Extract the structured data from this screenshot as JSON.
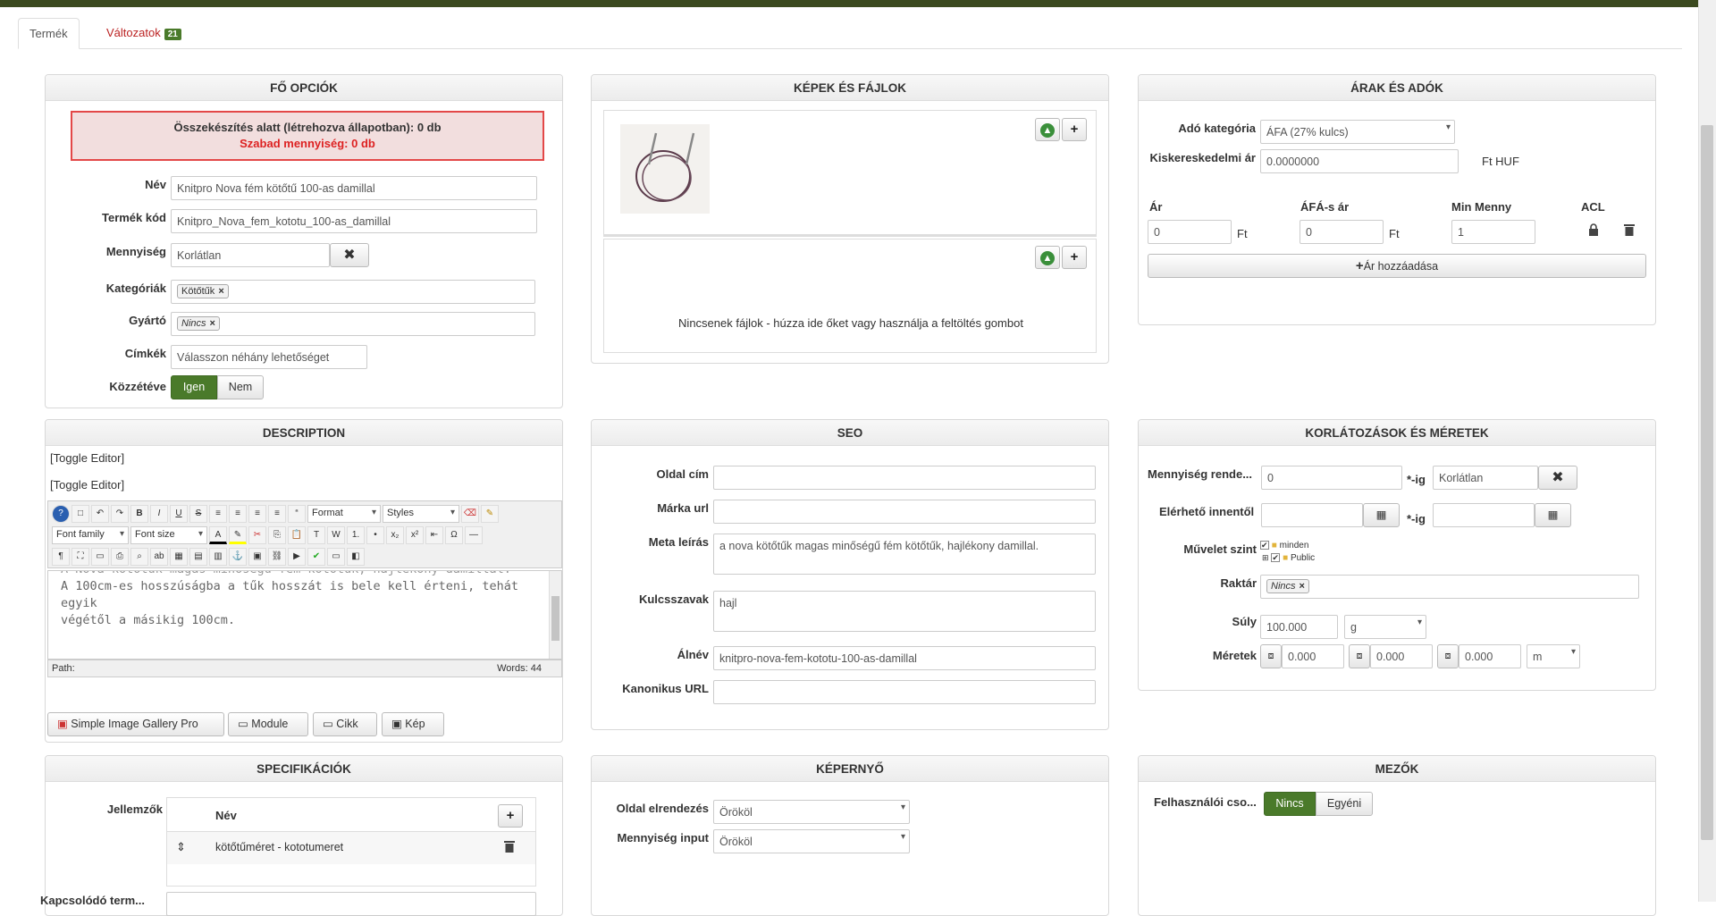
{
  "tabs": {
    "product": "Termék",
    "variants": "Változatok",
    "variants_count": "21"
  },
  "main": {
    "title": "FŐ OPCIÓK",
    "alert_line1": "Összekészítés alatt (létrehozva állapotban): 0 db",
    "alert_line2": "Szabad mennyiség: 0 db",
    "name_label": "Név",
    "name_value": "Knitpro Nova fém kötőtű 100-as damillal",
    "code_label": "Termék kód",
    "code_value": "Knitpro_Nova_fem_kototu_100-as_damillal",
    "qty_label": "Mennyiség",
    "qty_value": "Korlátlan",
    "cat_label": "Kategóriák",
    "cat_tag": "Kötőtűk",
    "maker_label": "Gyártó",
    "maker_tag": "Nincs",
    "tags_label": "Címkék",
    "tags_placeholder": "Válasszon néhány lehetőséget",
    "pub_label": "Közzétéve",
    "pub_yes": "Igen",
    "pub_no": "Nem"
  },
  "images": {
    "title": "KÉPEK ÉS FÁJLOK",
    "no_files": "Nincsenek fájlok - húzza ide őket vagy használja a feltöltés gombot"
  },
  "prices": {
    "title": "ÁRAK ÉS ADÓK",
    "tax_label": "Adó kategória",
    "tax_value": "ÁFA (27% kulcs)",
    "retail_label": "Kiskereskedelmi ár",
    "retail_value": "0.0000000",
    "retail_unit": "Ft HUF",
    "col_price": "Ár",
    "col_vat": "ÁFÁ-s ár",
    "col_min": "Min Menny",
    "col_acl": "ACL",
    "price_value": "0",
    "vat_value": "0",
    "min_value": "1",
    "ft": "Ft",
    "add_price": "Ár hozzáadása"
  },
  "description": {
    "title": "DESCRIPTION",
    "toggle1": "[Toggle Editor]",
    "toggle2": "[Toggle Editor]",
    "format": "Format",
    "styles": "Styles",
    "font_family": "Font family",
    "font_size": "Font size",
    "text_line0": "A Nova kötőtűk magas minőségű fém kötőtűk, hajlékony damillal.",
    "text_line1": "A 100cm-es hosszúságba a tűk hosszát is bele kell érteni, tehát egyik",
    "text_line2": "végétől a másikig 100cm.",
    "path": "Path:",
    "words": "Words: 44",
    "btn_gallery": "Simple Image Gallery Pro",
    "btn_module": "Module",
    "btn_article": "Cikk",
    "btn_image": "Kép"
  },
  "seo": {
    "title": "SEO",
    "page_title_label": "Oldal cím",
    "brand_url_label": "Márka url",
    "meta_label": "Meta leírás",
    "meta_value": "a nova kötőtűk magas minőségű fém kötőtűk, hajlékony damillal.",
    "keywords_label": "Kulcsszavak",
    "keywords_value": "hajl",
    "alias_label": "Álnév",
    "alias_value": "knitpro-nova-fem-kototu-100-as-damillal",
    "canonical_label": "Kanonikus URL"
  },
  "limits": {
    "title": "KORLÁTOZÁSOK ÉS MÉRETEK",
    "qty_order_label": "Mennyiség rende...",
    "qty_from": "0",
    "ig1": "*-ig",
    "qty_to": "Korlátlan",
    "avail_label": "Elérhető innentől",
    "ig2": "*-ig",
    "access_label": "Művelet szint",
    "tree1": "minden",
    "tree2": "Public",
    "warehouse_label": "Raktár",
    "warehouse_tag": "Nincs",
    "weight_label": "Súly",
    "weight_value": "100.000",
    "weight_unit": "g",
    "dims_label": "Méretek",
    "dim1": "0.000",
    "dim2": "0.000",
    "dim3": "0.000",
    "dim_unit": "m"
  },
  "specs": {
    "title": "SPECIFIKÁCIÓK",
    "features_label": "Jellemzők",
    "col_name": "Név",
    "row1": "kötőtűméret - kototumeret",
    "related_label": "Kapcsolódó term..."
  },
  "display": {
    "title": "KÉPERNYŐ",
    "layout_label": "Oldal elrendezés",
    "layout_value": "Örököl",
    "qtyinput_label": "Mennyiség input",
    "qtyinput_value": "Örököl"
  },
  "fields": {
    "title": "MEZŐK",
    "usergroup_label": "Felhasználói cso...",
    "opt_none": "Nincs",
    "opt_custom": "Egyéni"
  }
}
